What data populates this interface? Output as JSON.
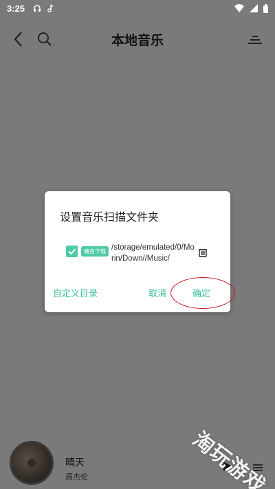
{
  "status_bar": {
    "time": "3:25",
    "icons_left": [
      "headphones-icon",
      "music-note-icon"
    ],
    "icons_right": [
      "wifi-icon",
      "signal-icon",
      "battery-icon"
    ]
  },
  "app_bar": {
    "title": "本地音乐",
    "icons": [
      "back-icon",
      "search-icon",
      "menu-icon"
    ]
  },
  "dialog": {
    "title": "设置音乐扫描文件夹",
    "folder": {
      "checked": true,
      "badge": "魔音下载",
      "path": "/storage/emulated/0/Morin/Down//Music/"
    },
    "custom_dir_label": "自定义目录",
    "cancel_label": "取消",
    "confirm_label": "确定"
  },
  "player": {
    "song": "晴天",
    "artist": "周杰伦"
  },
  "watermark": "淘玩游戏",
  "colors": {
    "accent": "#4fc9a6",
    "overlay": "#7a7a7a",
    "annotation": "#c8161e"
  }
}
